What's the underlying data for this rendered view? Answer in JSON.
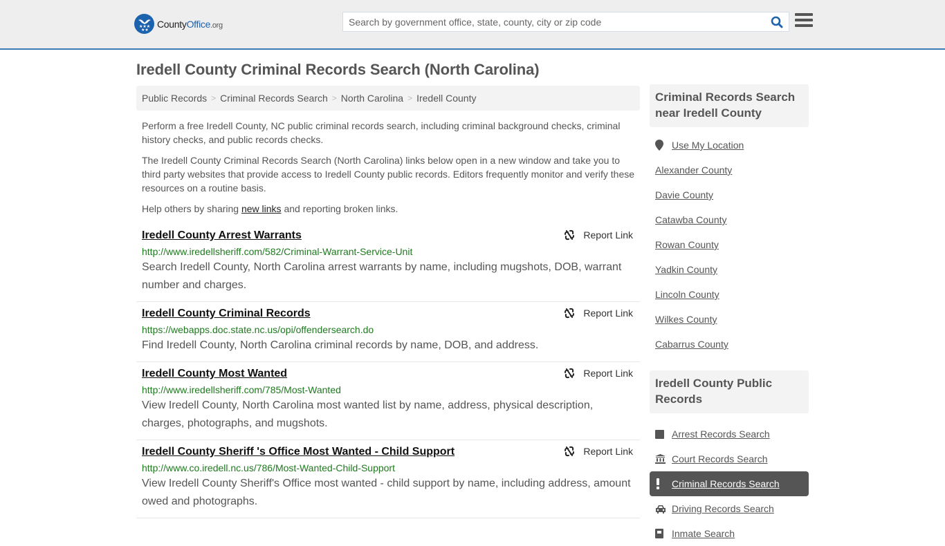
{
  "header": {
    "logo": {
      "county": "County",
      "office": "Office",
      "org": ".org"
    },
    "search": {
      "placeholder": "Search by government office, state, county, city or zip code",
      "value": ""
    },
    "search_icon": "search-icon",
    "menu_icon": "hamburger-menu-icon",
    "colors": {
      "brand_blue": "#1d62ad",
      "header_bg": "#eeeeee",
      "header_border": "#3c7ab3"
    }
  },
  "page_title": "Iredell County Criminal Records Search (North Carolina)",
  "breadcrumb": [
    "Public Records",
    "Criminal Records Search",
    "North Carolina",
    "Iredell County"
  ],
  "intro": {
    "p1": "Perform a free Iredell County, NC public criminal records search, including criminal background checks, criminal history checks, and public records checks.",
    "p2": "The Iredell County Criminal Records Search (North Carolina) links below open in a new window and take you to third party websites that provide access to Iredell County public records. Editors frequently monitor and verify these resources on a routine basis.",
    "p3_before": "Help others by sharing ",
    "p3_link": "new links",
    "p3_after": " and reporting broken links."
  },
  "results": [
    {
      "title": "Iredell County Arrest Warrants",
      "url": "http://www.iredellsheriff.com/582/Criminal-Warrant-Service-Unit",
      "description": "Search Iredell County, North Carolina arrest warrants by name, including mugshots, DOB, warrant number and charges.",
      "report_label": "Report Link"
    },
    {
      "title": "Iredell County Criminal Records",
      "url": "https://webapps.doc.state.nc.us/opi/offendersearch.do",
      "description": "Find Iredell County, North Carolina criminal records by name, DOB, and address.",
      "report_label": "Report Link"
    },
    {
      "title": "Iredell County Most Wanted",
      "url": "http://www.iredellsheriff.com/785/Most-Wanted",
      "description": "View Iredell County, North Carolina most wanted list by name, address, physical description, charges, photographs, and mugshots.",
      "report_label": "Report Link"
    },
    {
      "title": "Iredell County Sheriff 's Office Most Wanted - Child Support",
      "url": "http://www.co.iredell.nc.us/786/Most-Wanted-Child-Support",
      "description": "View Iredell County Sheriff's Office most wanted - child support by name, including address, amount owed and photographs.",
      "report_label": "Report Link"
    }
  ],
  "sidebar": {
    "near": {
      "heading": "Criminal Records Search near Iredell County",
      "use_location": "Use My Location",
      "counties": [
        "Alexander County",
        "Davie County",
        "Catawba County",
        "Rowan County",
        "Yadkin County",
        "Lincoln County",
        "Wilkes County",
        "Cabarrus County"
      ]
    },
    "public_records": {
      "heading": "Iredell County Public Records",
      "items": [
        {
          "label": "Arrest Records Search",
          "icon": "square-icon",
          "active": false
        },
        {
          "label": "Court Records Search",
          "icon": "courthouse-icon",
          "active": false
        },
        {
          "label": "Criminal Records Search",
          "icon": "exclamation-icon",
          "active": true
        },
        {
          "label": "Driving Records Search",
          "icon": "car-icon",
          "active": false
        },
        {
          "label": "Inmate Search",
          "icon": "inmate-icon",
          "active": false
        }
      ]
    }
  }
}
